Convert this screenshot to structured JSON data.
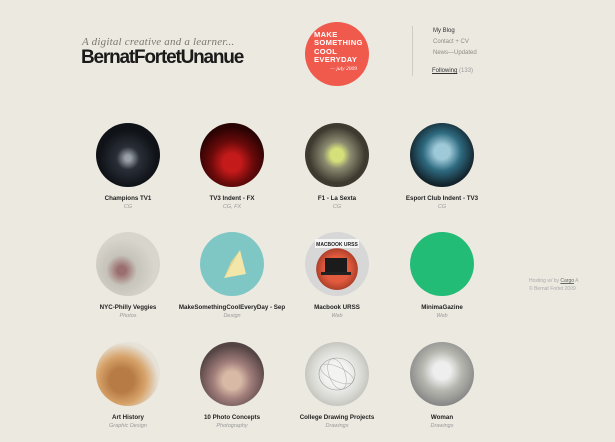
{
  "header": {
    "tagline": "A digital creative and a learner...",
    "brand": "BernatFortetUnanue"
  },
  "badge": {
    "lines": [
      "MAKE",
      "SOMETHING",
      "COOL",
      "EVERYDAY"
    ],
    "signature": "— july 2009",
    "color": "#ef5a4d"
  },
  "nav": {
    "blog": "My Blog",
    "contact": "Contact + CV",
    "news": "News—Updated",
    "following_label": "Following",
    "following_count": "(133)"
  },
  "projects": [
    {
      "title": "Champions TV1",
      "category": "CG",
      "icon": "stadium-thumb"
    },
    {
      "title": "TV3 Indent - FX",
      "category": "CG, FX",
      "icon": "racecar-thumb"
    },
    {
      "title": "F1 - La Sexta",
      "category": "CG",
      "icon": "f1-helmet-thumb"
    },
    {
      "title": "Esport Club Indent - TV3",
      "category": "CG",
      "icon": "esport-logo-thumb"
    },
    {
      "title": "NYC-Philly Veggies",
      "category": "Photos",
      "icon": "blossom-thumb"
    },
    {
      "title": "MakeSomethingCoolEveryDay - Sep",
      "category": "Design",
      "icon": "triangle-thumb"
    },
    {
      "title": "Macbook URSS",
      "category": "Web",
      "icon": "macbook-thumb"
    },
    {
      "title": "MinimaGazine",
      "category": "Web",
      "icon": "green-circle-thumb"
    },
    {
      "title": "Art History",
      "category": "Graphic Design",
      "icon": "book-thumb"
    },
    {
      "title": "10 Photo Concepts",
      "category": "Photography",
      "icon": "flower-thumb"
    },
    {
      "title": "College Drawing Projects",
      "category": "Drawings",
      "icon": "sphere-drawing-thumb"
    },
    {
      "title": "Woman",
      "category": "Drawings",
      "icon": "figure-drawing-thumb"
    }
  ],
  "sidebar": {
    "hosting_prefix": "Hosting w/ by",
    "hosting_link": "Cargo",
    "hosting_suffix": "A",
    "copyright": "© Bernat Fortet 2009"
  }
}
